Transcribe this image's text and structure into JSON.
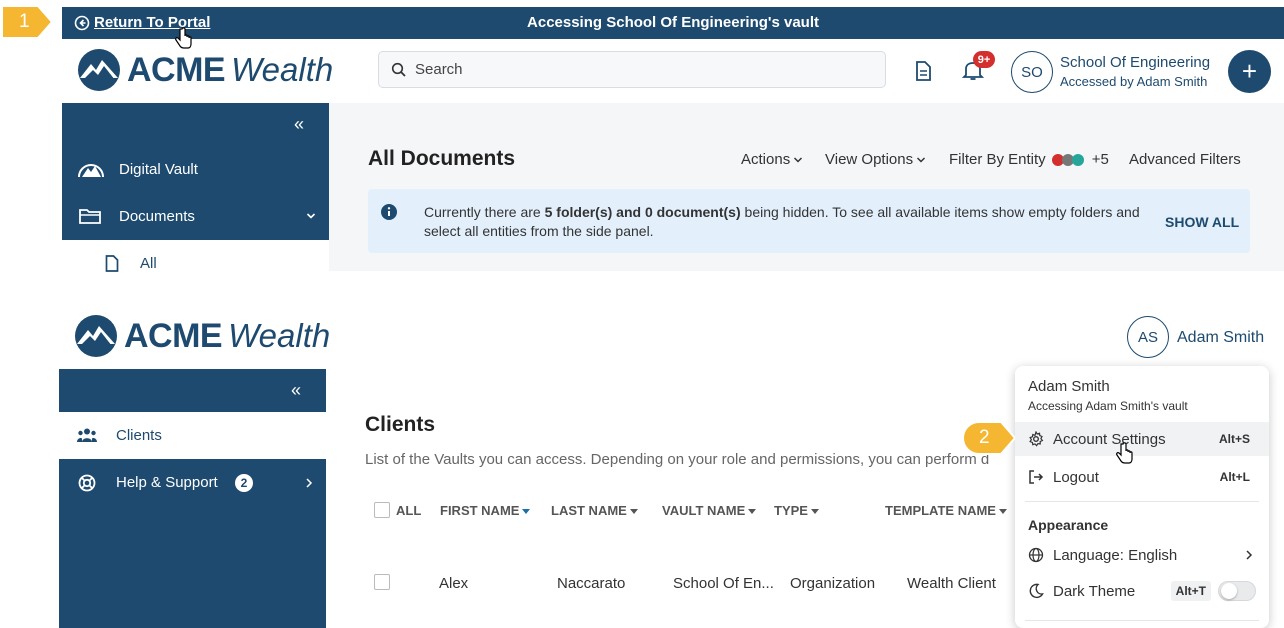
{
  "callouts": {
    "step1": "1",
    "step2": "2"
  },
  "banner": {
    "return_label": "Return To Portal",
    "title": "Accessing School Of Engineering's vault"
  },
  "brand": {
    "name_bold": "ACME",
    "name_italic": "Wealth"
  },
  "header1": {
    "search_placeholder": "Search",
    "notification_badge": "9+",
    "avatar_initials": "SO",
    "user_name": "School Of Engineering",
    "user_sub": "Accessed by Adam Smith",
    "add_label": "+"
  },
  "sidebar1": {
    "items": [
      {
        "label": "Digital Vault",
        "icon": "mountain-icon"
      },
      {
        "label": "Documents",
        "icon": "folder-icon"
      },
      {
        "label": "All",
        "icon": "file-icon"
      }
    ]
  },
  "documents": {
    "title": "All Documents",
    "actions": "Actions",
    "view_options": "View Options",
    "filter_entity": "Filter By Entity",
    "entity_more": "+5",
    "advanced_filters": "Advanced Filters",
    "entity_colors": [
      "#d32f2f",
      "#777777",
      "#26a69a"
    ],
    "info_text_1": "Currently there are ",
    "info_bold_1": "5 folder(s) and 0 document(s)",
    "info_text_2": " being hidden. To see all available items show empty folders and select all entities from the side panel.",
    "show_all": "SHOW ALL"
  },
  "header2": {
    "avatar_initials": "AS",
    "user_name": "Adam Smith"
  },
  "sidebar2": {
    "items": [
      {
        "label": "Clients",
        "icon": "users-icon"
      },
      {
        "label": "Help & Support",
        "icon": "lifebuoy-icon",
        "badge": "2"
      }
    ]
  },
  "clients": {
    "title": "Clients",
    "subtitle": "List of the Vaults you can access. Depending on your role and permissions, you can perform d",
    "columns": [
      "ALL",
      "FIRST NAME",
      "LAST NAME",
      "VAULT NAME",
      "TYPE",
      "TEMPLATE NAME"
    ],
    "rows": [
      {
        "first": "Alex",
        "last": "Naccarato",
        "vault": "School Of En...",
        "type": "Organization",
        "template": "Wealth Client"
      }
    ]
  },
  "menu": {
    "user_name": "Adam Smith",
    "user_sub": "Accessing Adam Smith's vault",
    "account_settings": "Account Settings",
    "account_settings_kbd": "Alt+S",
    "logout": "Logout",
    "logout_kbd": "Alt+L",
    "appearance": "Appearance",
    "language": "Language: English",
    "dark_theme": "Dark Theme",
    "dark_theme_kbd": "Alt+T"
  },
  "colors": {
    "navy": "#1d4a6e",
    "callout": "#f5b731",
    "accent_blue": "#1d6fa5"
  }
}
